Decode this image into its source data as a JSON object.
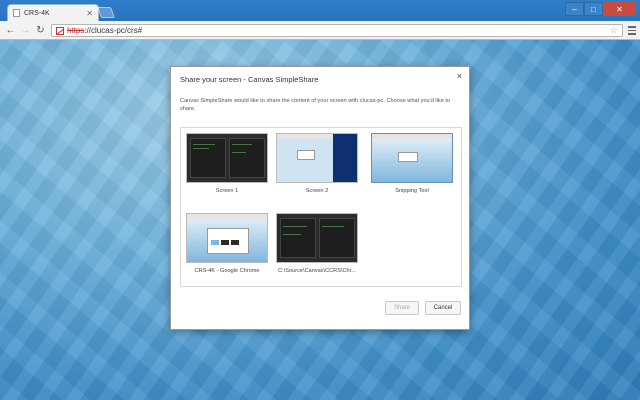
{
  "browser": {
    "tab_title": "CRS-4K",
    "url_scheme": "https",
    "url_rest": "://clucas-pc/crs#"
  },
  "dialog": {
    "title": "Share your screen - Canvas SimpleShare",
    "close_glyph": "×",
    "description": "Canvas SimpleShare would like to share the content of your screen with clucas-pc. Choose what you'd like to share.",
    "sources": [
      {
        "label": "Screen 1"
      },
      {
        "label": "Screen 2"
      },
      {
        "label": "Snipping Tool"
      },
      {
        "label": "CRS-4K - Google Chrome"
      },
      {
        "label": "C:\\Source\\Canvas\\CCRS\\Chr..."
      }
    ],
    "share_label": "Share",
    "cancel_label": "Cancel"
  },
  "colors": {
    "dialog_bg": "#ffffff",
    "titlebar": "#2f7ecb",
    "close_button": "#c74b3f"
  }
}
